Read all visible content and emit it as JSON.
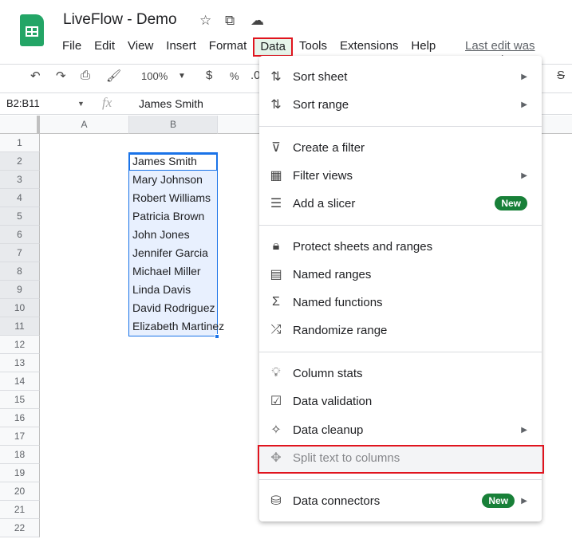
{
  "app": {
    "title": "LiveFlow - Demo",
    "last_edit": "Last edit was seconds ago"
  },
  "menubar": [
    "File",
    "Edit",
    "View",
    "Insert",
    "Format",
    "Data",
    "Tools",
    "Extensions",
    "Help"
  ],
  "toolbar": {
    "zoom": "100%",
    "currency": "$",
    "percent": "%",
    "decimal": ".0"
  },
  "formula_bar": {
    "name_box": "B2:B11",
    "fx": "fx",
    "value": "James Smith"
  },
  "columns": [
    "A",
    "B"
  ],
  "rows": [
    "1",
    "2",
    "3",
    "4",
    "5",
    "6",
    "7",
    "8",
    "9",
    "10",
    "11",
    "12",
    "13",
    "14",
    "15",
    "16",
    "17",
    "18",
    "19",
    "20",
    "21",
    "22"
  ],
  "cells_b": [
    "James Smith",
    "Mary Johnson",
    "Robert Williams",
    "Patricia Brown",
    "John Jones",
    "Jennifer Garcia",
    "Michael Miller",
    "Linda Davis",
    "David Rodriguez",
    "Elizabeth Martinez"
  ],
  "data_menu": [
    {
      "label": "Sort sheet",
      "icon": "sort-icon",
      "submenu": true
    },
    {
      "label": "Sort range",
      "icon": "sort-icon",
      "submenu": true
    },
    {
      "label": "Create a filter",
      "icon": "filter-icon"
    },
    {
      "label": "Filter views",
      "icon": "filter-views-icon",
      "submenu": true
    },
    {
      "label": "Add a slicer",
      "icon": "slicer-icon",
      "badge": "New"
    },
    {
      "label": "Protect sheets and ranges",
      "icon": "lock-icon"
    },
    {
      "label": "Named ranges",
      "icon": "named-ranges-icon"
    },
    {
      "label": "Named functions",
      "icon": "sigma-icon"
    },
    {
      "label": "Randomize range",
      "icon": "shuffle-icon"
    },
    {
      "label": "Column stats",
      "icon": "lightbulb-icon"
    },
    {
      "label": "Data validation",
      "icon": "validation-icon"
    },
    {
      "label": "Data cleanup",
      "icon": "magic-wand-icon",
      "submenu": true
    },
    {
      "label": "Split text to columns",
      "icon": "split-icon",
      "highlighted": true
    },
    {
      "label": "Data connectors",
      "icon": "database-icon",
      "badge": "New",
      "submenu": true
    }
  ],
  "colors": {
    "accent": "#1a73e8",
    "highlight": "#e0141e",
    "badge": "#188038"
  }
}
